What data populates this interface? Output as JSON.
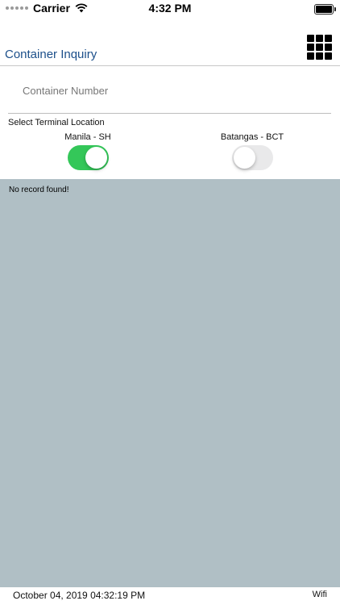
{
  "status_bar": {
    "carrier": "Carrier",
    "time": "4:32 PM"
  },
  "nav": {
    "title": "Container Inquiry",
    "menu_icon": "grid-menu-icon"
  },
  "form": {
    "container_placeholder": "Container Number",
    "container_value": "",
    "terminal_section_label": "Select Terminal Location",
    "terminals": [
      {
        "label": "Manila - SH",
        "on": true
      },
      {
        "label": "Batangas - BCT",
        "on": false
      }
    ]
  },
  "results": {
    "message": "No record found!"
  },
  "footer": {
    "timestamp": "October 04, 2019 04:32:19 PM",
    "network": "Wifi"
  },
  "colors": {
    "title": "#1c4f8a",
    "toggle_on": "#34c759",
    "toggle_off": "#e9e9ea",
    "results_bg": "#b0bfc5"
  }
}
